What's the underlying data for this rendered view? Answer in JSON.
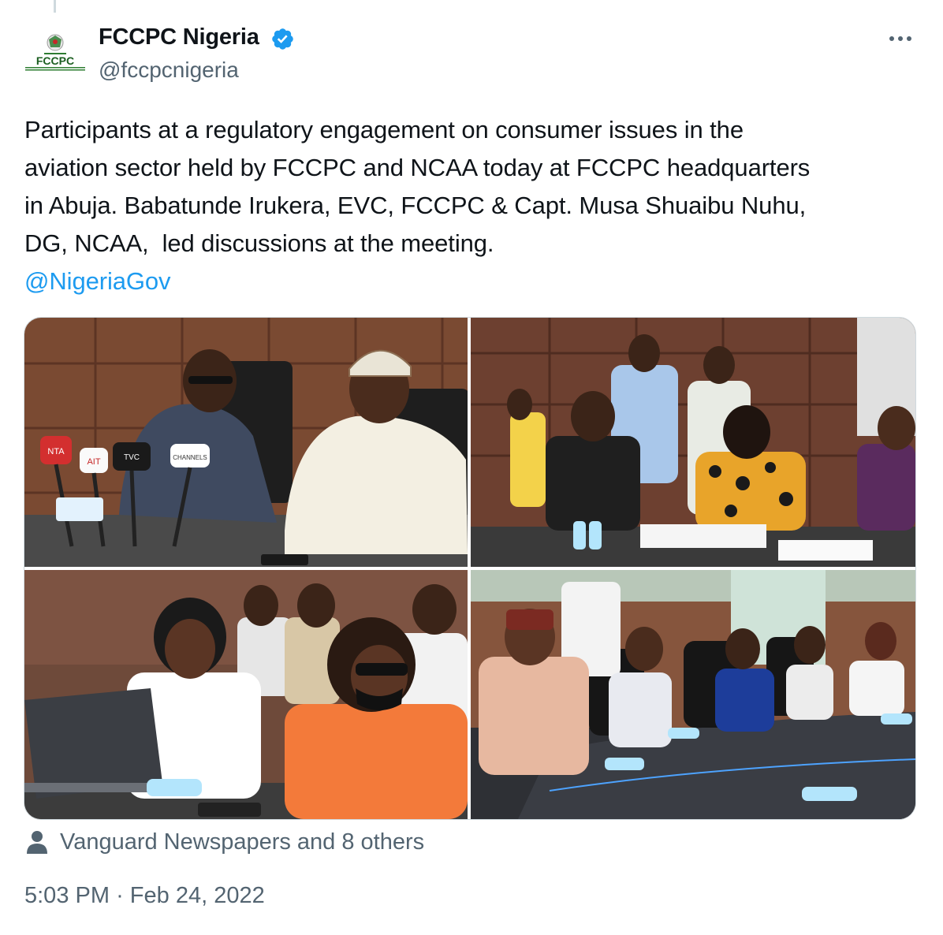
{
  "author": {
    "display_name": "FCCPC Nigeria",
    "handle": "@fccpcnigeria",
    "verified": true,
    "avatar_text": "FCCPC",
    "avatar_icon": "fccpc-logo-icon"
  },
  "tweet": {
    "text_lines": [
      "Participants at a regulatory engagement on consumer issues in the",
      "aviation sector held by FCCPC and NCAA today at FCCPC headquarters",
      "in Abuja. Babatunde Irukera, EVC, FCCPC & Capt. Musa Shuaibu Nuhu,",
      "DG, NCAA,  led discussions at the meeting."
    ],
    "mention": "@NigeriaGov"
  },
  "media": {
    "count": 4,
    "photos": [
      {
        "name": "photo-two-officials-press-microphones"
      },
      {
        "name": "photo-participants-seated-at-table"
      },
      {
        "name": "photo-women-participants-laptop"
      },
      {
        "name": "photo-participants-long-conference-table"
      }
    ],
    "press_mic_labels": [
      "NTA",
      "AIT",
      "TVC",
      "CHANNELS"
    ]
  },
  "tagged": {
    "text": "Vanguard Newspapers and 8 others",
    "icon": "person-icon"
  },
  "timestamp": {
    "time": "5:03 PM",
    "separator": "·",
    "date": "Feb 24, 2022"
  },
  "colors": {
    "text_primary": "#0f1419",
    "text_secondary": "#536471",
    "link": "#1d9bf0",
    "verified_badge": "#1d9bf0",
    "border": "#cfd9de"
  }
}
